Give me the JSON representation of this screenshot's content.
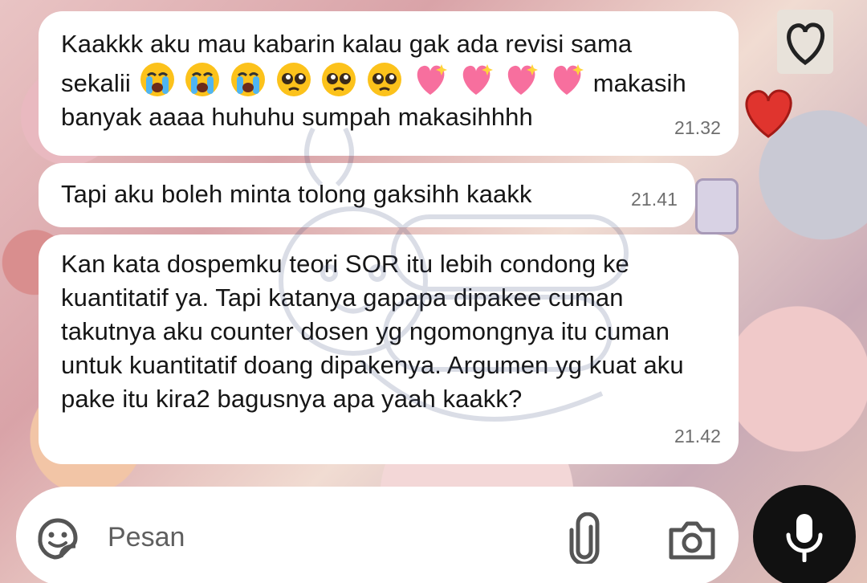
{
  "messages": [
    {
      "text_line1": "Kaakkk aku mau kabarin kalau gak ada revisi sama",
      "text_before_emoji": "sekalii",
      "emojis": [
        "loudly-crying-face",
        "loudly-crying-face",
        "loudly-crying-face",
        "pleading-face",
        "pleading-face",
        "pleading-face",
        "sparkling-heart",
        "sparkling-heart",
        "sparkling-heart",
        "sparkling-heart"
      ],
      "text_after_emoji": "makasih",
      "text_line3": "banyak aaaa huhuhu sumpah makasihhhh",
      "time": "21.32"
    },
    {
      "text": "Tapi aku boleh minta tolong gaksihh kaakk",
      "time": "21.41"
    },
    {
      "text": "Kan kata dospemku teori SOR itu lebih condong ke kuantitatif ya. Tapi katanya gapapa dipakee cuman takutnya aku counter dosen yg ngomongnya itu cuman untuk kuantitatif doang dipakenya. Argumen yg kuat aku pake itu kira2 bagusnya apa yaah kaakk?",
      "time": "21.42"
    }
  ],
  "input": {
    "placeholder": "Pesan"
  },
  "icons": {
    "sticker": "sticker-icon",
    "attach": "paperclip-icon",
    "camera": "camera-icon",
    "mic": "microphone-icon"
  },
  "colors": {
    "bubble": "#ffffff",
    "time": "#6e6e6e",
    "mic_button": "#111111"
  }
}
